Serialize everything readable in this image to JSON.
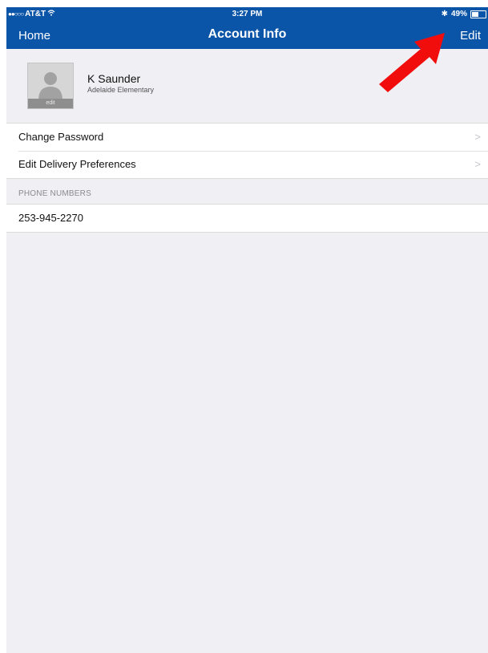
{
  "status_bar": {
    "carrier": "AT&T",
    "time": "3:27 PM",
    "battery": "49%",
    "battery_level": 0.49
  },
  "nav": {
    "back_label": "Home",
    "title": "Account Info",
    "edit_label": "Edit"
  },
  "profile": {
    "avatar_edit_label": "edit",
    "name": "K Saunder",
    "school": "Adelaide Elementary"
  },
  "menu": {
    "items": [
      {
        "label": "Change Password"
      },
      {
        "label": "Edit Delivery Preferences"
      }
    ]
  },
  "phone": {
    "section_title": "PHONE NUMBERS",
    "numbers": [
      "253-945-2270"
    ]
  },
  "annotation": {
    "arrow_color": "#f20d0d",
    "arrow_target": "Edit"
  },
  "colors": {
    "header": "#0b55a8",
    "background": "#efeff4"
  }
}
